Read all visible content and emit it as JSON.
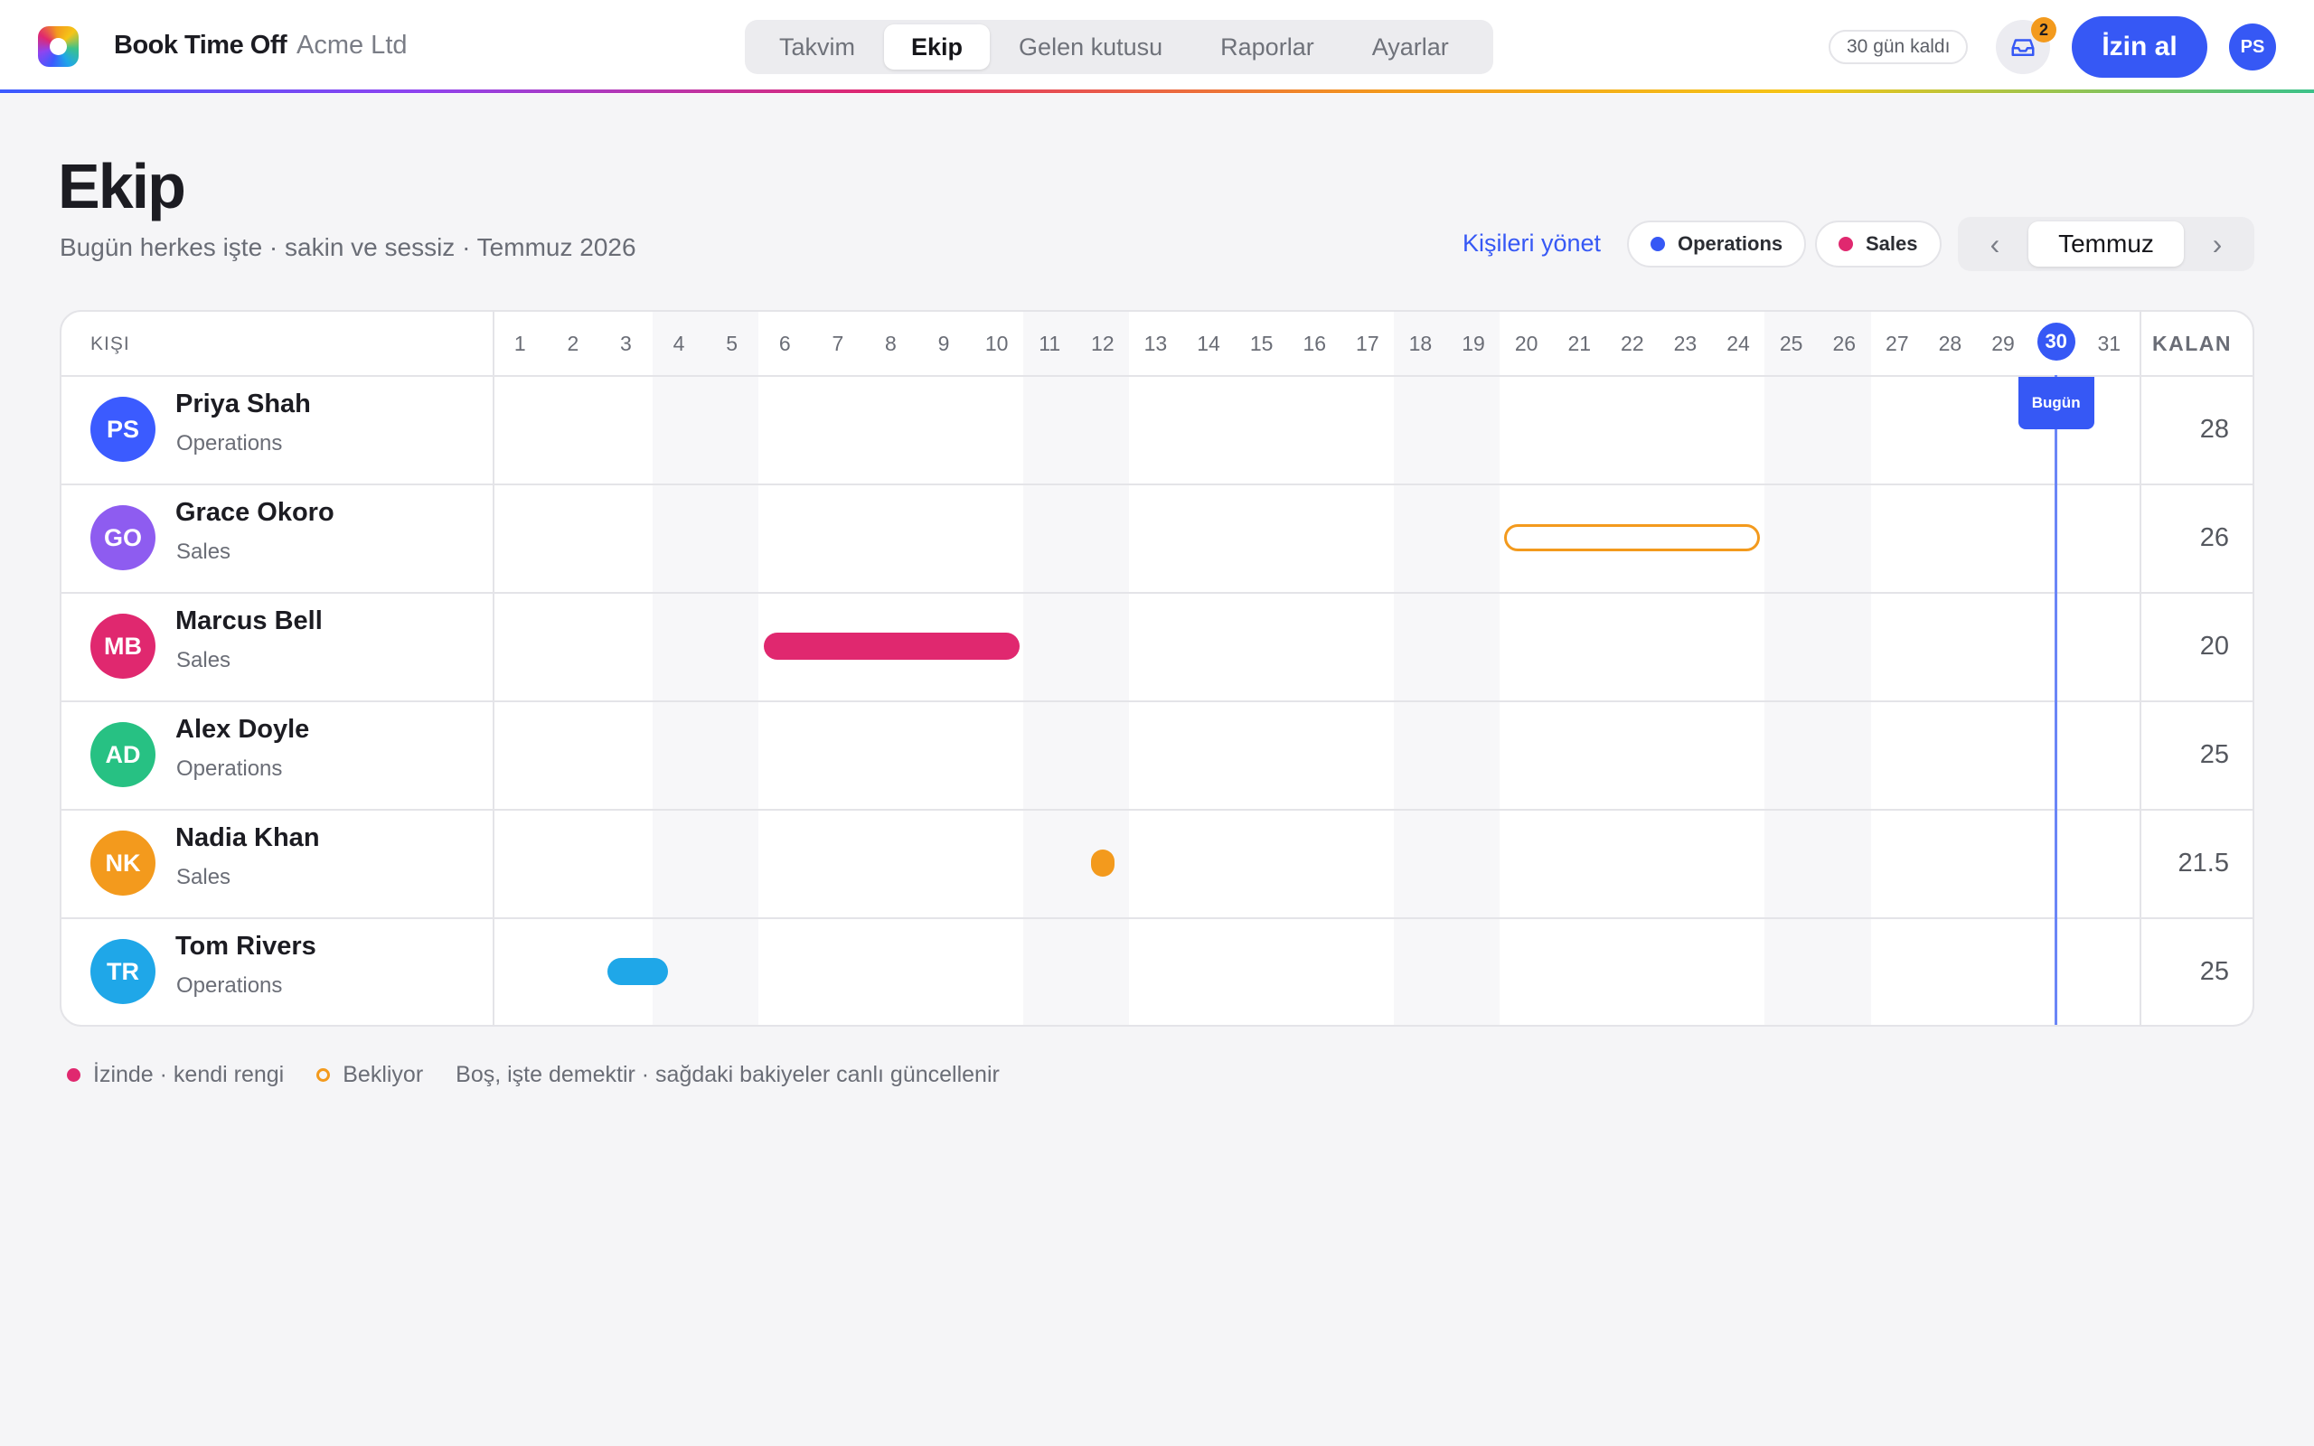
{
  "app": {
    "brand": "Book Time Off",
    "company": "Acme Ltd",
    "tabs": [
      {
        "label": "Takvim",
        "active": false
      },
      {
        "label": "Ekip",
        "active": true
      },
      {
        "label": "Gelen kutusu",
        "active": false
      },
      {
        "label": "Raporlar",
        "active": false
      },
      {
        "label": "Ayarlar",
        "active": false
      }
    ],
    "days_left": "30 gün kaldı",
    "inbox_icon": "inbox-icon",
    "inbox_count": "2",
    "book_button": "İzin al",
    "user_initials": "PS"
  },
  "page": {
    "title": "Ekip",
    "subtitle": "Bugün herkes işte · sakin ve sessiz · Temmuz 2026",
    "manage_link": "Kişileri yönet",
    "teams": [
      {
        "name": "Operations",
        "color": "#3658f5"
      },
      {
        "name": "Sales",
        "color": "#e0286f"
      }
    ],
    "month": "Temmuz",
    "prev_arrow": "‹",
    "next_arrow": "›"
  },
  "grid": {
    "person_header": "KIŞI",
    "balance_header": "KALAN",
    "days": [
      "1",
      "2",
      "3",
      "4",
      "5",
      "6",
      "7",
      "8",
      "9",
      "10",
      "11",
      "12",
      "13",
      "14",
      "15",
      "16",
      "17",
      "18",
      "19",
      "20",
      "21",
      "22",
      "23",
      "24",
      "25",
      "26",
      "27",
      "28",
      "29",
      "30",
      "31"
    ],
    "weekends": [
      4,
      5,
      11,
      12,
      18,
      19,
      25,
      26
    ],
    "today": 30,
    "today_label": "Bugün",
    "people": [
      {
        "initials": "PS",
        "name": "Priya Shah",
        "team": "Operations",
        "color": "#3b5bff",
        "balance": "28",
        "leave": []
      },
      {
        "initials": "GO",
        "name": "Grace Okoro",
        "team": "Sales",
        "color": "#8e5cf0",
        "balance": "26",
        "leave": [
          {
            "start": 20,
            "end": 24,
            "status": "pending"
          }
        ]
      },
      {
        "initials": "MB",
        "name": "Marcus Bell",
        "team": "Sales",
        "color": "#e0286f",
        "balance": "20",
        "leave": [
          {
            "start": 6,
            "end": 10,
            "status": "approved"
          }
        ]
      },
      {
        "initials": "AD",
        "name": "Alex Doyle",
        "team": "Operations",
        "color": "#27c183",
        "balance": "25",
        "leave": []
      },
      {
        "initials": "NK",
        "name": "Nadia Khan",
        "team": "Sales",
        "color": "#f39a1d",
        "balance": "21.5",
        "leave": [
          {
            "start": 12,
            "end": 12,
            "status": "approved-half"
          }
        ]
      },
      {
        "initials": "TR",
        "name": "Tom Rivers",
        "team": "Operations",
        "color": "#1fa7e8",
        "balance": "25",
        "leave": [
          {
            "start": 3,
            "end": 3,
            "status": "approved"
          }
        ]
      }
    ]
  },
  "legend": {
    "on_leave": "İzinde · kendi rengi",
    "pending": "Bekliyor",
    "note": "Boş, işte demektir · sağdaki bakiyeler canlı güncellenir"
  }
}
